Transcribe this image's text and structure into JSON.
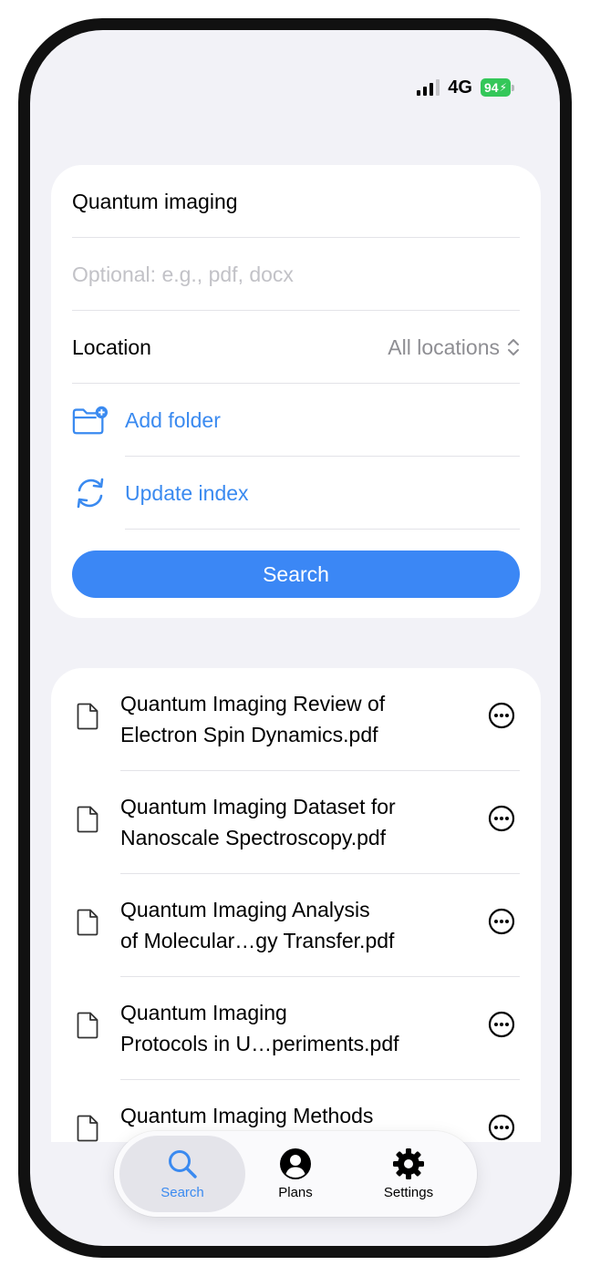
{
  "status_bar": {
    "network": "4G",
    "battery": "94"
  },
  "search_form": {
    "query": "Quantum imaging",
    "filetype_placeholder": "Optional: e.g., pdf, docx",
    "location_label": "Location",
    "location_value": "All locations",
    "add_folder_label": "Add folder",
    "update_index_label": "Update index",
    "search_button_label": "Search"
  },
  "results": [
    {
      "line1": "Quantum Imaging Review of",
      "line2": "Electron Spin Dynamics.pdf"
    },
    {
      "line1": "Quantum Imaging Dataset for",
      "line2": "Nanoscale Spectroscopy.pdf"
    },
    {
      "line1": "Quantum Imaging Analysis",
      "line2": "of Molecular…gy Transfer.pdf"
    },
    {
      "line1": "Quantum Imaging",
      "line2": "Protocols in U…periments.pdf"
    },
    {
      "line1": "Quantum Imaging Methods",
      "line2": ""
    }
  ],
  "tab_bar": {
    "tabs": [
      {
        "label": "Search",
        "icon": "magnifier-icon",
        "active": true
      },
      {
        "label": "Plans",
        "icon": "person-icon",
        "active": false
      },
      {
        "label": "Settings",
        "icon": "gear-icon",
        "active": false
      }
    ]
  },
  "colors": {
    "accent": "#3a8af0",
    "button": "#3b87f5",
    "background": "#f2f2f7",
    "battery": "#34c759"
  }
}
